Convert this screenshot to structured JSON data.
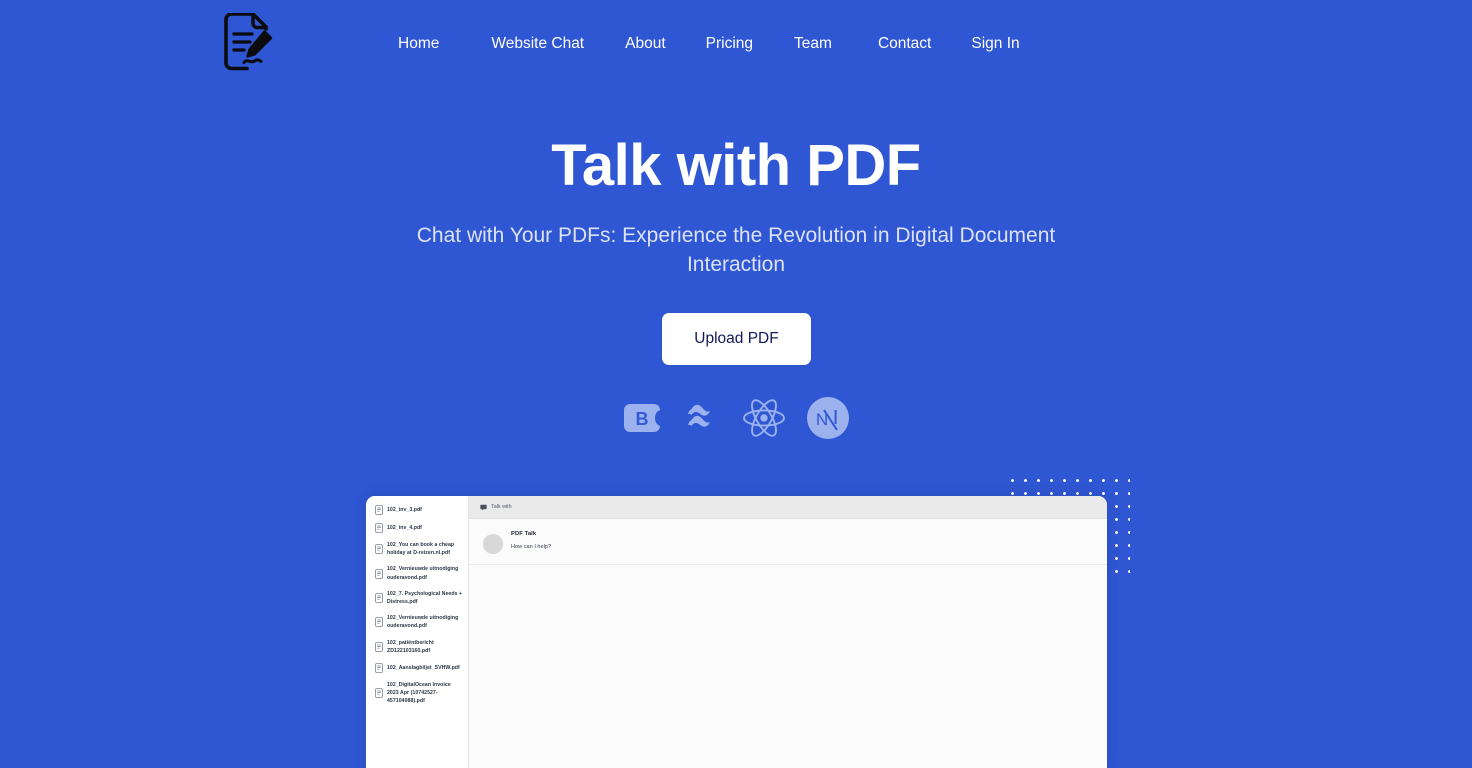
{
  "theme": {
    "background": "#2F56D3",
    "accent_white": "#FFFFFF",
    "subtitle_color": "#DCE2F8",
    "button_text_color": "#12195A",
    "tech_icon_color": "#A9BCF0"
  },
  "header": {
    "logo_name": "document-pen-logo",
    "nav": [
      {
        "label": "Home"
      },
      {
        "label": "Website Chat"
      },
      {
        "label": "About"
      },
      {
        "label": "Pricing"
      },
      {
        "label": "Team"
      },
      {
        "label": "Contact"
      },
      {
        "label": "Sign In"
      }
    ]
  },
  "hero": {
    "title": "Talk with PDF",
    "subtitle": "Chat with Your PDFs: Experience the Revolution in Digital Document Interaction",
    "cta_label": "Upload PDF"
  },
  "tech_icons": [
    {
      "name": "bootstrap-icon",
      "label": "B"
    },
    {
      "name": "tailwind-icon",
      "label": ""
    },
    {
      "name": "react-icon",
      "label": ""
    },
    {
      "name": "nextjs-icon",
      "label": "N"
    }
  ],
  "mockup": {
    "files": [
      {
        "name": "102_inv_3.pdf"
      },
      {
        "name": "102_inv_4.pdf"
      },
      {
        "name": "102_You can book a cheap holiday at D-reizen.nl.pdf"
      },
      {
        "name": "102_Vernieuwde uitnodiging ouderavond.pdf"
      },
      {
        "name": "102_7. Psychological Needs + Distress.pdf"
      },
      {
        "name": "102_Vernieuwde uitnodiging ouderavond.pdf"
      },
      {
        "name": "102_patiëntbericht ZD122103160.pdf"
      },
      {
        "name": "102_Aanslagbiljet_SVHW.pdf"
      },
      {
        "name": "102_DigitalOcean Invoice 2023 Apr (10742527-457104088).pdf"
      }
    ],
    "chat": {
      "tab_label": "Talk with",
      "message_author": "PDF Talk",
      "message_text": "How can I help?"
    }
  }
}
